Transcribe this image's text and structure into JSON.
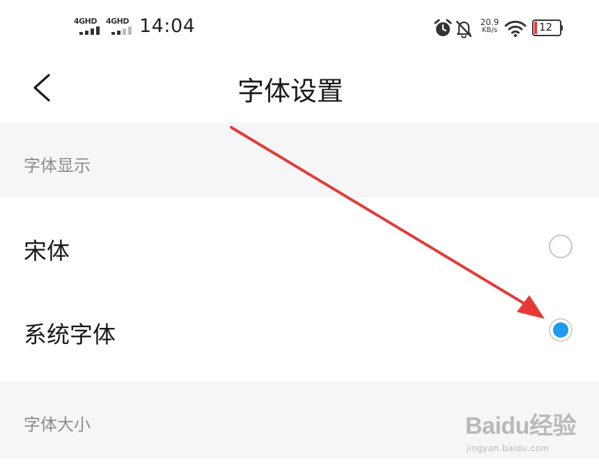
{
  "status_bar": {
    "signal1_net": "4GHD",
    "signal2_net": "4GHD",
    "time": "14:04",
    "net_speed_value": "20.9",
    "net_speed_unit": "KB/s",
    "battery_level": "12",
    "battery_color": "#e53935",
    "icons": [
      "alarm-icon",
      "bell-off-icon",
      "wifi-icon",
      "battery-icon"
    ]
  },
  "header": {
    "title": "字体设置",
    "back_icon": "chevron-left-icon"
  },
  "sections": {
    "font_display": {
      "title": "字体显示",
      "options": [
        {
          "label": "宋体",
          "selected": false
        },
        {
          "label": "系统字体",
          "selected": true
        }
      ]
    },
    "font_size": {
      "title": "字体大小"
    }
  },
  "colors": {
    "accent": "#1e9bf0",
    "section_background": "#f6f6f6",
    "annotation_arrow": "#e53935"
  },
  "watermark": {
    "logo": "Baidu经验",
    "url": "jingyan.baidu.com"
  }
}
